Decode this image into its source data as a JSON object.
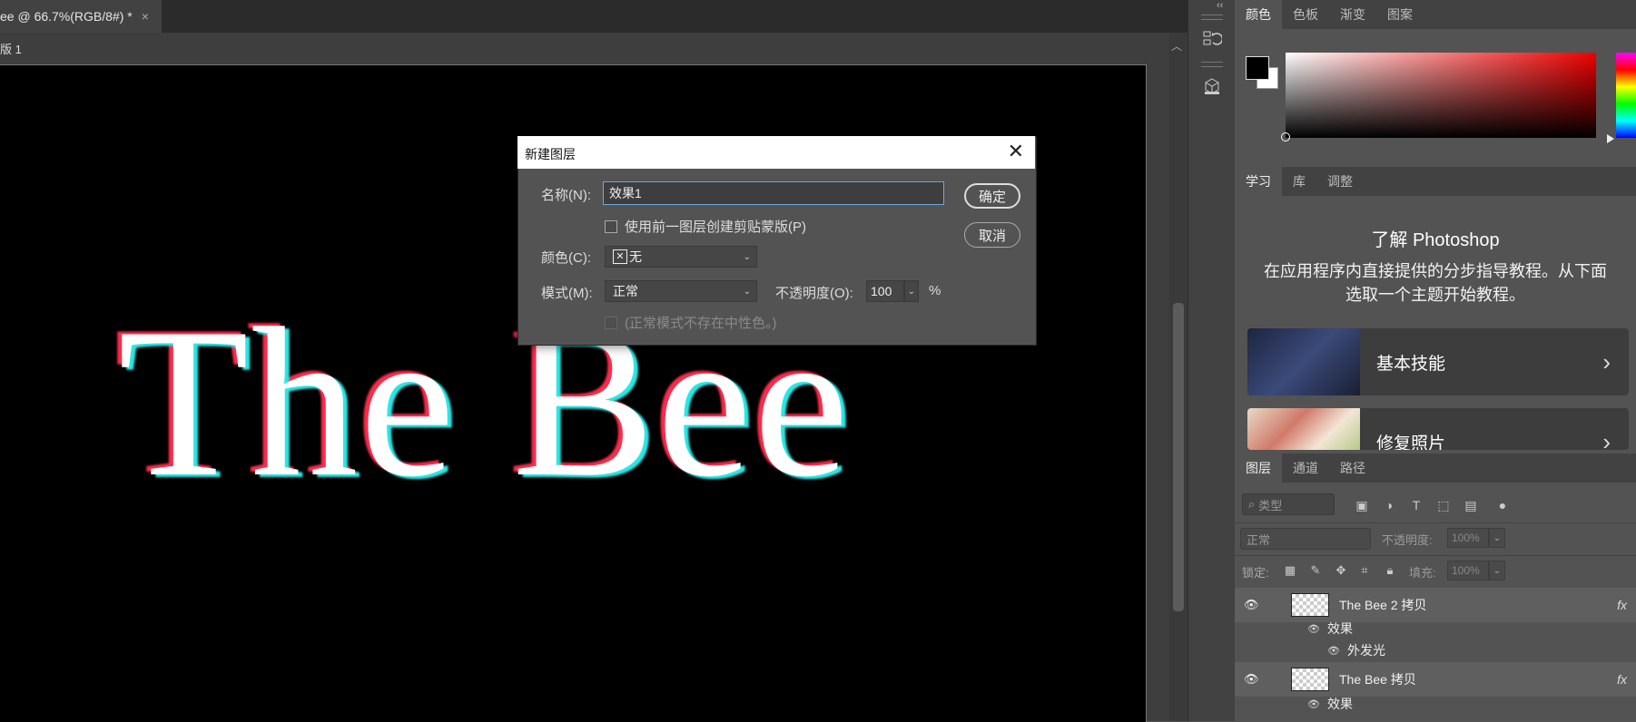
{
  "document": {
    "tab_title": "ee @ 66.7%(RGB/8#) *",
    "tab_close": "×",
    "artboard_label": "版 1",
    "canvas_text": "The Bee"
  },
  "strip": {
    "collapse": "‹‹"
  },
  "color_panel": {
    "tabs": [
      "颜色",
      "色板",
      "渐变",
      "图案"
    ],
    "foreground": "#000000",
    "background": "#ffffff"
  },
  "learn_panel": {
    "tabs": [
      "学习",
      "库",
      "调整"
    ],
    "title": "了解 Photoshop",
    "description": "在应用程序内直接提供的分步指导教程。从下面选取一个主题开始教程。",
    "cards": [
      {
        "label": "基本技能",
        "chevron": "›"
      },
      {
        "label": "修复照片",
        "chevron": "›"
      }
    ]
  },
  "layers_panel": {
    "tabs": [
      "图层",
      "通道",
      "路径"
    ],
    "search_placeholder": "类型",
    "blend_mode": "正常",
    "opacity_label": "不透明度:",
    "opacity_value": "100%",
    "lock_label": "锁定:",
    "fill_label": "填充:",
    "fill_value": "100%",
    "layers": [
      {
        "name": "The Bee 2 拷贝",
        "fx": "fx",
        "effects_label": "效果",
        "effect": "外发光"
      },
      {
        "name": "The Bee 拷贝",
        "fx": "fx",
        "effects_label": "效果"
      }
    ]
  },
  "dialog": {
    "title": "新建图层",
    "close": "✕",
    "name_label": "名称(N):",
    "name_value": "效果1",
    "clip_label": "使用前一图层创建剪贴蒙版(P)",
    "color_label": "颜色(C):",
    "color_value": "无",
    "mode_label": "模式(M):",
    "mode_value": "正常",
    "opacity_label": "不透明度(O):",
    "opacity_value": "100",
    "percent": "%",
    "neutral_label": "(正常模式不存在中性色。)",
    "ok_label": "确定",
    "cancel_label": "取消"
  }
}
